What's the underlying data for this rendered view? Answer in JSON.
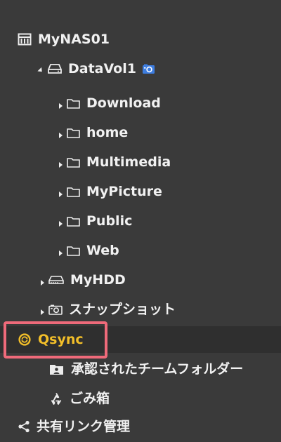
{
  "tree": {
    "root": {
      "label": "MyNAS01",
      "icon": "server-icon"
    },
    "volume": {
      "label": "DataVol1",
      "icon": "drive-icon",
      "badge_icon": "snapshot-badge-icon"
    },
    "folders": [
      {
        "label": "Download",
        "icon": "folder-icon"
      },
      {
        "label": "home",
        "icon": "folder-icon"
      },
      {
        "label": "Multimedia",
        "icon": "folder-icon"
      },
      {
        "label": "MyPicture",
        "icon": "folder-icon"
      },
      {
        "label": "Public",
        "icon": "folder-icon"
      },
      {
        "label": "Web",
        "icon": "folder-icon"
      }
    ],
    "hdd": {
      "label": "MyHDD",
      "icon": "external-drive-icon"
    },
    "snapshot": {
      "label": "スナップショット",
      "icon": "camera-icon"
    },
    "qsync": {
      "label": "Qsync",
      "icon": "qsync-icon",
      "color": "#f3bf29"
    },
    "approved_team_folders": {
      "label": "承認されたチームフォルダー",
      "icon": "team-folder-icon"
    },
    "trash": {
      "label": "ごみ箱",
      "icon": "recycle-icon"
    },
    "share_links": {
      "label": "共有リンク管理",
      "icon": "share-icon"
    }
  },
  "highlight_color": "#ef6a7a"
}
